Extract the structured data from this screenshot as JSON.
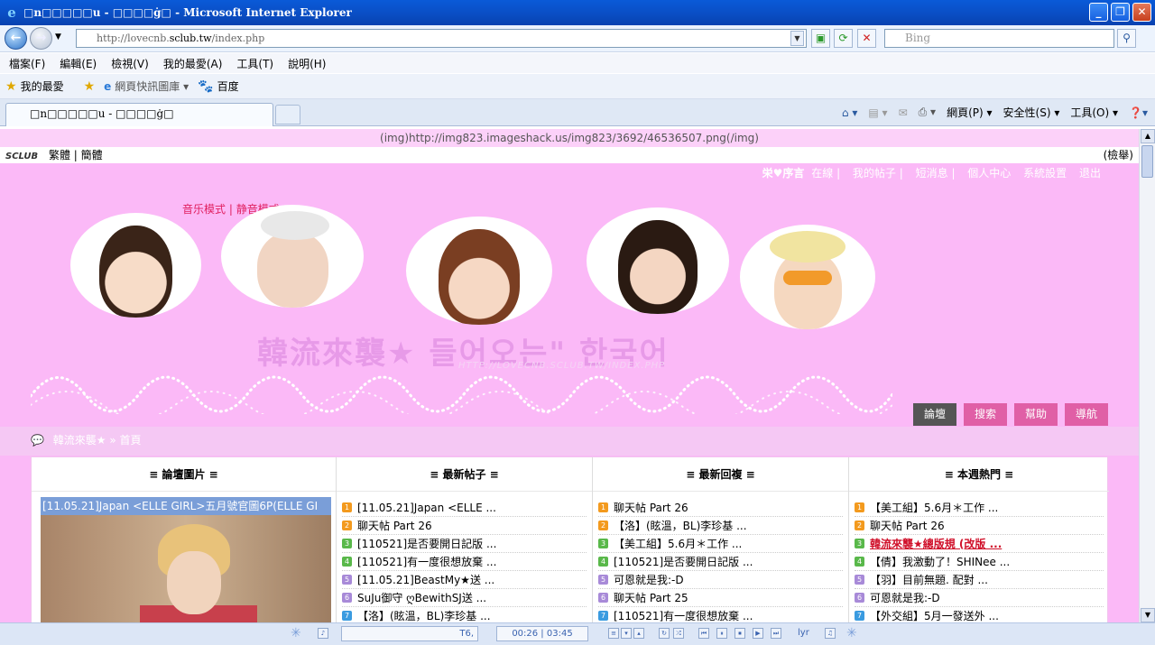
{
  "window": {
    "title": "□n□□□□□u - □□□□ġ□ - Microsoft Internet Explorer"
  },
  "address": {
    "url_pre": "http://lovecnb.",
    "url_dom": "sclub.tw",
    "url_post": "/index.php",
    "search_placeholder": "Bing"
  },
  "menu": [
    "檔案(F)",
    "編輯(E)",
    "檢視(V)",
    "我的最愛(A)",
    "工具(T)",
    "說明(H)"
  ],
  "favbar": {
    "favorites": "我的最愛",
    "gallery": "網頁快訊圖庫 ▾",
    "baidu": "百度"
  },
  "tab": {
    "title": "□n□□□□□u - □□□□ġ□"
  },
  "cmd": {
    "page": "網頁(P) ▾",
    "safety": "安全性(S) ▾",
    "tools": "工具(O) ▾"
  },
  "site": {
    "img_line": "(img)http://img823.imageshack.us/img823/3692/46536507.png(/img)",
    "logo": "SCLUB",
    "trad": "繁體",
    "simp": "簡體",
    "search_label": "(檢舉)",
    "user": [
      "栄♥序言",
      "在線",
      "我的帖子",
      "短消息",
      "個人中心",
      "系統設置",
      "退出"
    ],
    "mode_music": "音乐模式",
    "mode_silent": "静音模式",
    "banner_name": "韓流來襲★  들어오는\" 한국어",
    "banner_url": "HTTP://LOVECNB.SCLUB.TW/INDEX.PHP",
    "tabs": [
      "論壇",
      "搜索",
      "幫助",
      "導航"
    ],
    "crumb_home": "韓流來襲★",
    "crumb_sep": "»",
    "crumb_index": "首頁"
  },
  "columns": {
    "pics": {
      "head": "≡ 論壇圖片 ≡",
      "caption": "[11.05.21]Japan <ELLE GIRL>五月號官圖6P(ELLE GI"
    },
    "new_posts": {
      "head": "≡ 最新帖子 ≡",
      "items": [
        "[11.05.21]Japan <ELLE ...",
        "聊天帖 Part 26",
        "[110521]是否要開日記版 ...",
        "[110521]有一度很想放棄 ...",
        "[11.05.21]BeastMy★送 ...",
        "SuJu御守 ღBewithSJ送 ...",
        "【洛】(眩溫，BL)李珍基 ..."
      ]
    },
    "new_replies": {
      "head": "≡ 最新回複 ≡",
      "items": [
        "聊天帖 Part 26",
        "【洛】(眩溫，BL)李珍基 ...",
        "【美工組】5.6月＊工作 ...",
        "[110521]是否要開日記版 ...",
        "可恩就是我:-D",
        "聊天帖 Part 25",
        "[110521]有一度很想放棄 ..."
      ]
    },
    "hot": {
      "head": "≡ 本週熱門 ≡",
      "items": [
        "【美工組】5.6月＊工作 ...",
        "聊天帖 Part 26",
        "韓流來襲★總版規 (改版 ...",
        "【倩】我激動了！SHINee ...",
        "【羽】目前無題. 配對 ...",
        "可恩就是我:-D",
        "【外交組】5月一發送外 ..."
      ]
    }
  },
  "player": {
    "track": "T6,",
    "time": "00:26 | 03:45"
  }
}
